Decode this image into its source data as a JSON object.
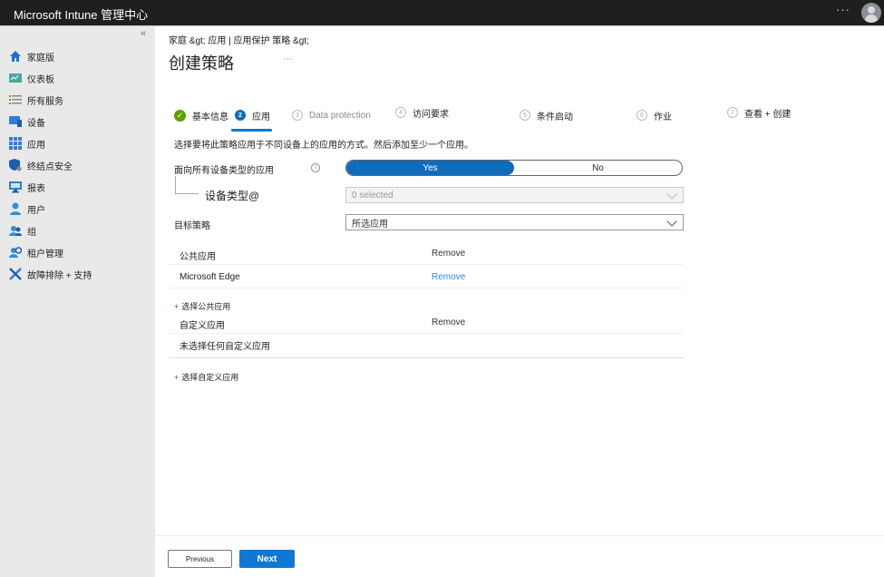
{
  "header": {
    "app_title": "Microsoft Intune 管理中心",
    "more_label": "···",
    "avatar_icon": "user-avatar-icon"
  },
  "sidebar": {
    "collapse_label": "«",
    "items": [
      {
        "label": "家庭版",
        "icon": "home-icon"
      },
      {
        "label": "仪表板",
        "icon": "dashboard-icon"
      },
      {
        "label": "所有服务",
        "icon": "list-icon"
      },
      {
        "label": "设备",
        "icon": "devices-icon"
      },
      {
        "label": "应用",
        "icon": "apps-grid-icon"
      },
      {
        "label": "终结点安全",
        "icon": "shield-icon"
      },
      {
        "label": "报表",
        "icon": "reports-monitor-icon"
      },
      {
        "label": "用户",
        "icon": "user-icon"
      },
      {
        "label": "组",
        "icon": "group-icon"
      },
      {
        "label": "租户管理",
        "icon": "tenant-admin-icon"
      },
      {
        "label": "故障排除 + 支持",
        "icon": "troubleshoot-wrench-icon"
      }
    ]
  },
  "breadcrumb": "家庭 &gt;  应用 | 应用保护 策略  &gt;",
  "page": {
    "title": "创建策略",
    "title_more": "···"
  },
  "wizard": {
    "steps": [
      {
        "number": "✓",
        "label": "基本信息",
        "state": "done"
      },
      {
        "number": "2",
        "label": "应用",
        "state": "active"
      },
      {
        "number": "3",
        "label": "Data protection",
        "state": "future"
      },
      {
        "number": "4",
        "label": "访问要求",
        "state": "future"
      },
      {
        "number": "5",
        "label": "条件启动",
        "state": "future"
      },
      {
        "number": "6",
        "label": "作业",
        "state": "future"
      },
      {
        "number": "7",
        "label": "查看 + 创建",
        "state": "future"
      }
    ]
  },
  "form": {
    "instruction": "选择要将此策略应用于不同设备上的应用的方式。然后添加至少一个应用。",
    "target_all_label": "面向所有设备类型的应用",
    "info_icon": "i",
    "toggle": {
      "yes": "Yes",
      "no": "No",
      "selected": "Yes"
    },
    "device_types_label": "设备类型@",
    "device_types_value": "0 selected",
    "target_policy_label": "目标策略",
    "target_policy_value": "所选应用"
  },
  "public_apps": {
    "header": "公共应用",
    "header_action": "Remove",
    "items": [
      {
        "name": "Microsoft Edge",
        "action": "Remove"
      }
    ],
    "add_label": "选择公共应用"
  },
  "custom_apps": {
    "header": "自定义应用",
    "header_action": "Remove",
    "empty_text": "未选择任何自定义应用",
    "add_label": "选择自定义应用"
  },
  "footer": {
    "previous_label": "Previous",
    "next_label": "Next"
  },
  "colors": {
    "accent": "#0f6cbd",
    "success": "#57a300",
    "link": "#2b88d8",
    "topbar": "#1f1f1f",
    "sidebar": "#e9e9e9"
  }
}
